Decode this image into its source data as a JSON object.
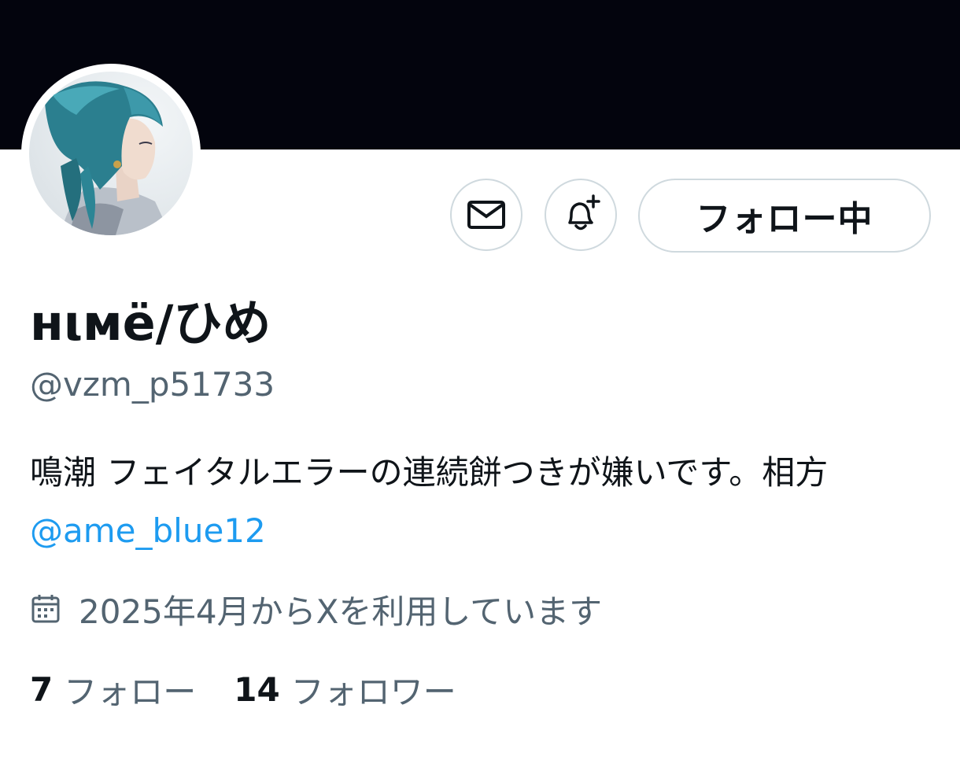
{
  "profile": {
    "display_name": "нιмё/ひめ",
    "handle": "@vzm_p51733",
    "bio_text": "鳴潮 フェイタルエラーの連続餅つきが嫌いです。相方",
    "bio_mention": "@ame_blue12",
    "joined": "2025年4月からXを利用しています",
    "following_count": "7",
    "following_label": "フォロー",
    "followers_count": "14",
    "followers_label": "フォロワー"
  },
  "actions": {
    "follow_label": "フォロー中",
    "message_icon": "mail-icon",
    "notify_icon": "bell-plus-icon"
  },
  "icons": {
    "calendar": "calendar-icon"
  },
  "colors": {
    "banner": "#03040d",
    "text_primary": "#0f1419",
    "text_secondary": "#536471",
    "link": "#1d9bf0",
    "border": "#cfd9de"
  }
}
